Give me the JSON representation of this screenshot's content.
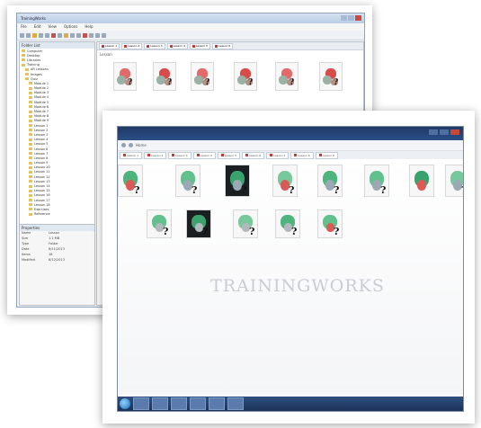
{
  "back_window": {
    "title": "TrainingWorks",
    "menu": [
      "File",
      "Edit",
      "View",
      "Options",
      "Help"
    ],
    "left_header": "Folder List",
    "tree": [
      "Computer",
      "Desktop",
      "Libraries",
      "Training",
      "AR Lessons",
      "Images",
      "Quiz",
      "Module 1",
      "Module 2",
      "Module 3",
      "Module 4",
      "Module 5",
      "Module 6",
      "Module 7",
      "Module 8",
      "Module 9",
      "Lesson 1",
      "Lesson 2",
      "Lesson 3",
      "Lesson 4",
      "Lesson 5",
      "Lesson 6",
      "Lesson 7",
      "Lesson 8",
      "Lesson 9",
      "Lesson 10",
      "Lesson 11",
      "Lesson 12",
      "Lesson 13",
      "Lesson 14",
      "Lesson 15",
      "Lesson 16",
      "Lesson 17",
      "Lesson 18",
      "Exercises",
      "Reference"
    ],
    "props_header": "Properties",
    "props": [
      [
        "Name",
        "Lesson"
      ],
      [
        "Size",
        "1.2 MB"
      ],
      [
        "Type",
        "Folder"
      ],
      [
        "Date",
        "6/11/2013"
      ],
      [
        "Items",
        "18"
      ],
      [
        "Modified",
        "6/12/2013"
      ]
    ],
    "tabs": [
      "Lesson 1",
      "Lesson 2",
      "Lesson 3",
      "Lesson 4",
      "Lesson 5",
      "Lesson 6"
    ],
    "path": "Lesson"
  },
  "front_window": {
    "address": "Home",
    "tabs": [
      "Lesson 1",
      "Lesson 2",
      "Lesson 3",
      "Lesson 4",
      "Lesson 5",
      "Lesson 6",
      "Lesson 7",
      "Lesson 8",
      "Lesson 9"
    ],
    "watermark": "TRAININGWORKS"
  },
  "colors": {
    "titlebar": "#1f3a66",
    "taskbar": "#1b3258",
    "tab_marker": "#c23b3b",
    "watermark": "#c9ccd1"
  }
}
